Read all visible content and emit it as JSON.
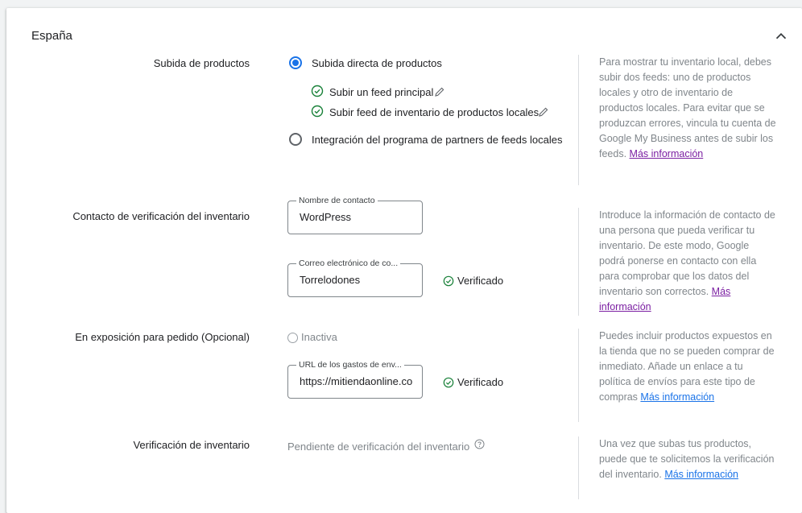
{
  "section": {
    "title": "España"
  },
  "upload": {
    "label": "Subida de productos",
    "option_direct": "Subida directa de productos",
    "sub_main_feed": "Subir un feed principal",
    "sub_local_feed": "Subir feed de inventario de productos locales",
    "option_partner": "Integración del programa de partners de feeds locales",
    "help_text": "Para mostrar tu inventario local, debes subir dos feeds: uno de productos locales y otro de inventario de productos locales. Para evitar que se produzcan errores, vincula tu cuenta de Google My Business antes de subir los feeds.",
    "help_link": "Más información"
  },
  "contact": {
    "label": "Contacto de verificación del inventario",
    "name_legend": "Nombre de contacto",
    "name_value": "WordPress",
    "email_legend": "Correo electrónico de co...",
    "email_value": "Torrelodones",
    "email_status": "Verificado",
    "help_text": "Introduce la información de contacto de una persona que pueda verificar tu inventario. De este modo, Google podrá ponerse en contacto con ella para comprobar que los datos del inventario son correctos.",
    "help_link": "Más información"
  },
  "display": {
    "label": "En exposición para pedido (Opcional)",
    "status": "Inactiva",
    "url_legend": "URL de los gastos de env...",
    "url_value": "https://mitiendaonline.com",
    "url_status": "Verificado",
    "help_text": "Puedes incluir productos expuestos en la tienda que no se pueden comprar de inmediato. Añade un enlace a tu política de envíos para este tipo de compras",
    "help_link": "Más información"
  },
  "verification": {
    "label": "Verificación de inventario",
    "status": "Pendiente de verificación del inventario",
    "help_text": "Una vez que subas tus productos, puede que te solicitemos la verificación del inventario.",
    "help_link": "Más información"
  },
  "colors": {
    "accent": "#1a73e8",
    "success": "#188038",
    "visited_link": "#7b1fa2",
    "muted": "#80868b"
  },
  "icons": {
    "collapse": "chevron-up-icon",
    "check": "check-circle-icon",
    "edit": "pencil-icon",
    "help": "help-circle-icon"
  }
}
